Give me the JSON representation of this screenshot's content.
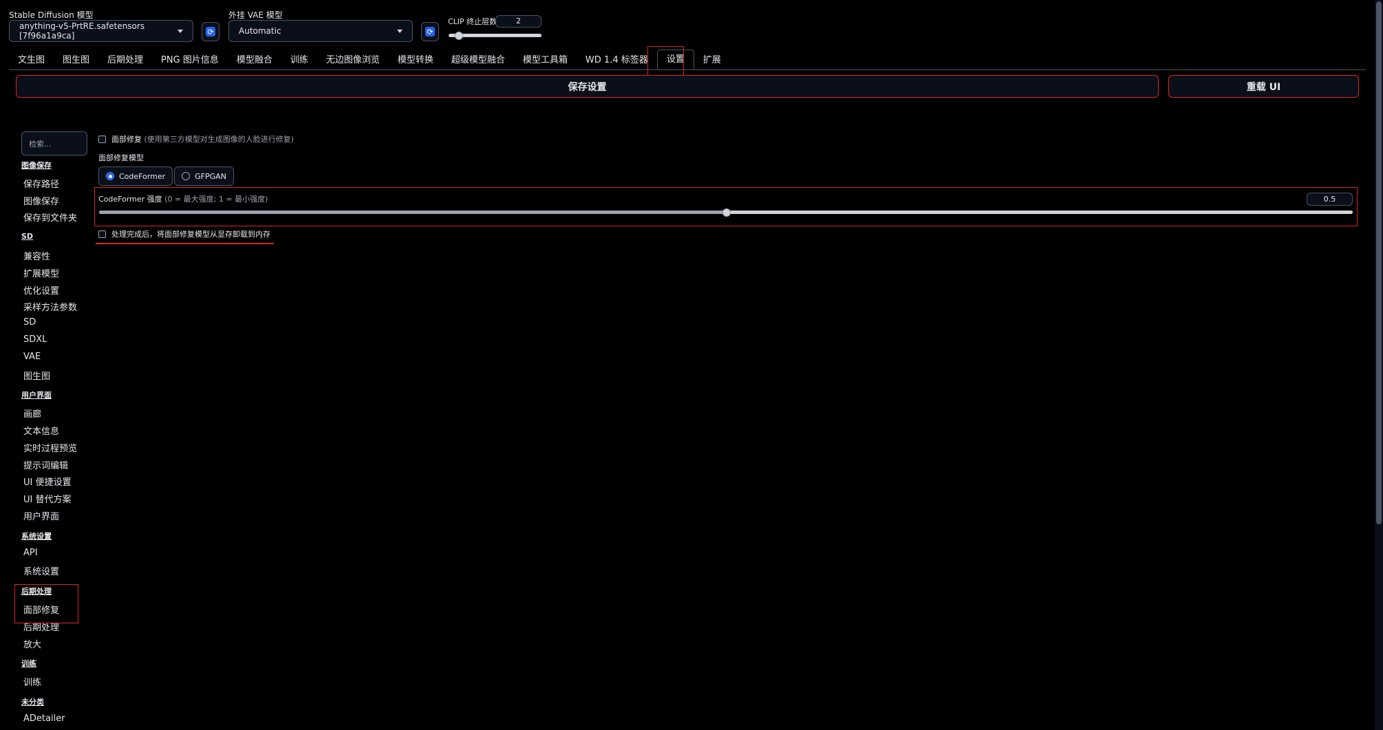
{
  "top": {
    "sd_model_label": "Stable Diffusion 模型",
    "sd_model_value": "anything-v5-PrtRE.safetensors [7f96a1a9ca]",
    "vae_label": "外挂 VAE 模型",
    "vae_value": "Automatic",
    "clip_label": "CLIP 终止层数",
    "clip_value": "2",
    "clip_slider_fraction": 0.1
  },
  "tabs": [
    "文生图",
    "图生图",
    "后期处理",
    "PNG 图片信息",
    "模型融合",
    "训练",
    "无边图像浏览",
    "模型转换",
    "超级模型融合",
    "模型工具箱",
    "WD 1.4 标签器",
    "设置",
    "扩展"
  ],
  "active_tab": "设置",
  "actions": {
    "save": "保存设置",
    "reload": "重载 UI"
  },
  "sidebar": {
    "search_placeholder": "检索...",
    "sections": [
      {
        "title": "图像保存",
        "items": [
          "保存路径",
          "图像保存",
          "保存到文件夹"
        ]
      },
      {
        "title": "SD",
        "items": [
          "兼容性",
          "扩展模型",
          "优化设置",
          "采样方法参数",
          "SD",
          "SDXL",
          "VAE",
          "图生图"
        ]
      },
      {
        "title": "用户界面",
        "items": [
          "画廊",
          "文本信息",
          "实时过程预览",
          "提示词编辑",
          "UI 便捷设置",
          "UI 替代方案",
          "用户界面"
        ]
      },
      {
        "title": "系统设置",
        "items": [
          "API",
          "系统设置"
        ]
      },
      {
        "title": "后期处理",
        "items": [
          "面部修复",
          "后期处理",
          "放大"
        ]
      },
      {
        "title": "训练",
        "items": [
          "训练"
        ]
      },
      {
        "title": "未分类",
        "items": [
          "ADetailer"
        ]
      }
    ]
  },
  "settings": {
    "face_restore_label": "面部修复",
    "face_restore_hint": "(使用第三方模型对生成图像的人脸进行修复)",
    "face_model_label": "面部修复模型",
    "face_model_options": [
      "CodeFormer",
      "GFPGAN"
    ],
    "face_model_selected": "CodeFormer",
    "codeformer_label": "CodeFormer 强度",
    "codeformer_hint": "(0 = 最大强度; 1 = 最小强度)",
    "codeformer_value": "0.5",
    "codeformer_fraction": 0.5,
    "unload_label": "处理完成后，将面部修复模型从显存卸载到内存"
  },
  "colors": {
    "accent": "#2563eb",
    "highlight": "#dc2626",
    "background": "#000000"
  }
}
